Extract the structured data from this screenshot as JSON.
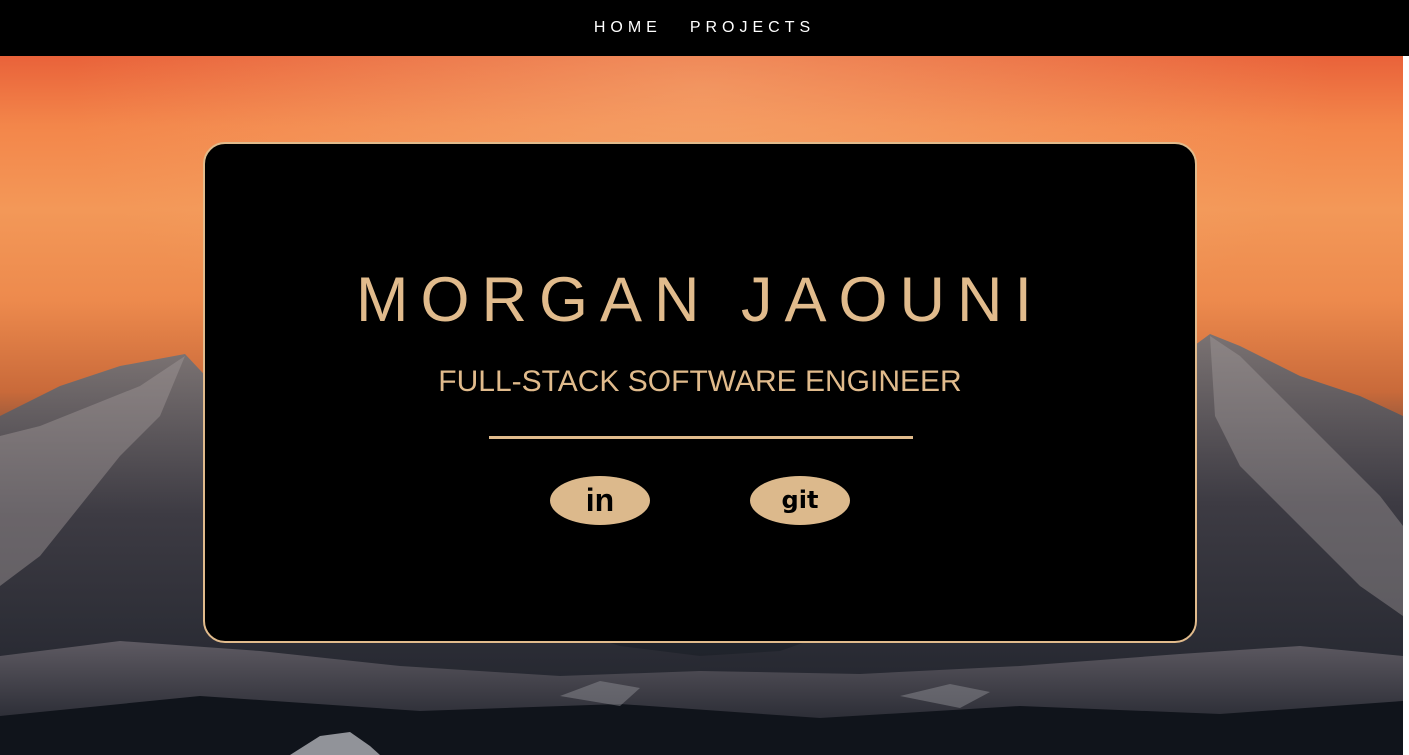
{
  "nav": {
    "items": [
      {
        "label": "HOME"
      },
      {
        "label": "PROJECTS"
      }
    ]
  },
  "hero": {
    "name": "MORGAN JAOUNI",
    "subtitle": "FULL-STACK SOFTWARE ENGINEER",
    "accent_color": "#e1bb8c"
  },
  "social": {
    "linkedin": {
      "label": "in",
      "icon": "linkedin-icon"
    },
    "git": {
      "label": "git",
      "icon": "git-icon"
    }
  }
}
